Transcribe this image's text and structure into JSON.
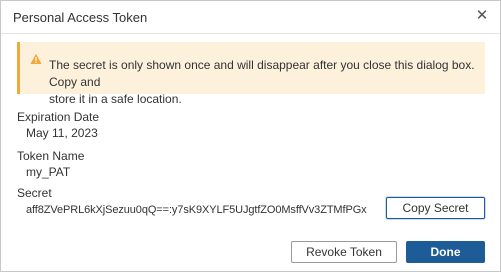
{
  "dialog": {
    "title": "Personal Access Token",
    "close_icon": "close-icon"
  },
  "alert": {
    "icon": "warning-icon",
    "accent_color": "#f2a93b",
    "background_color": "#fdf1dc",
    "line1": "The secret is only shown once and will disappear after you close this dialog box. Copy and",
    "line2": "store it in a safe location."
  },
  "fields": {
    "expiration_label": "Expiration Date",
    "expiration_value": "May 11, 2023",
    "token_name_label": "Token Name",
    "token_name_value": "my_PAT",
    "secret_label": "Secret",
    "secret_value": "aff8ZVePRL6kXjSezuu0qQ==:y7sK9XYLF5UJgtfZO0MsffVv3ZTMfPGx"
  },
  "buttons": {
    "copy_secret": "Copy Secret",
    "revoke_token": "Revoke Token",
    "done": "Done"
  },
  "colors": {
    "primary": "#1d5c97",
    "border": "#c8c8c8"
  }
}
